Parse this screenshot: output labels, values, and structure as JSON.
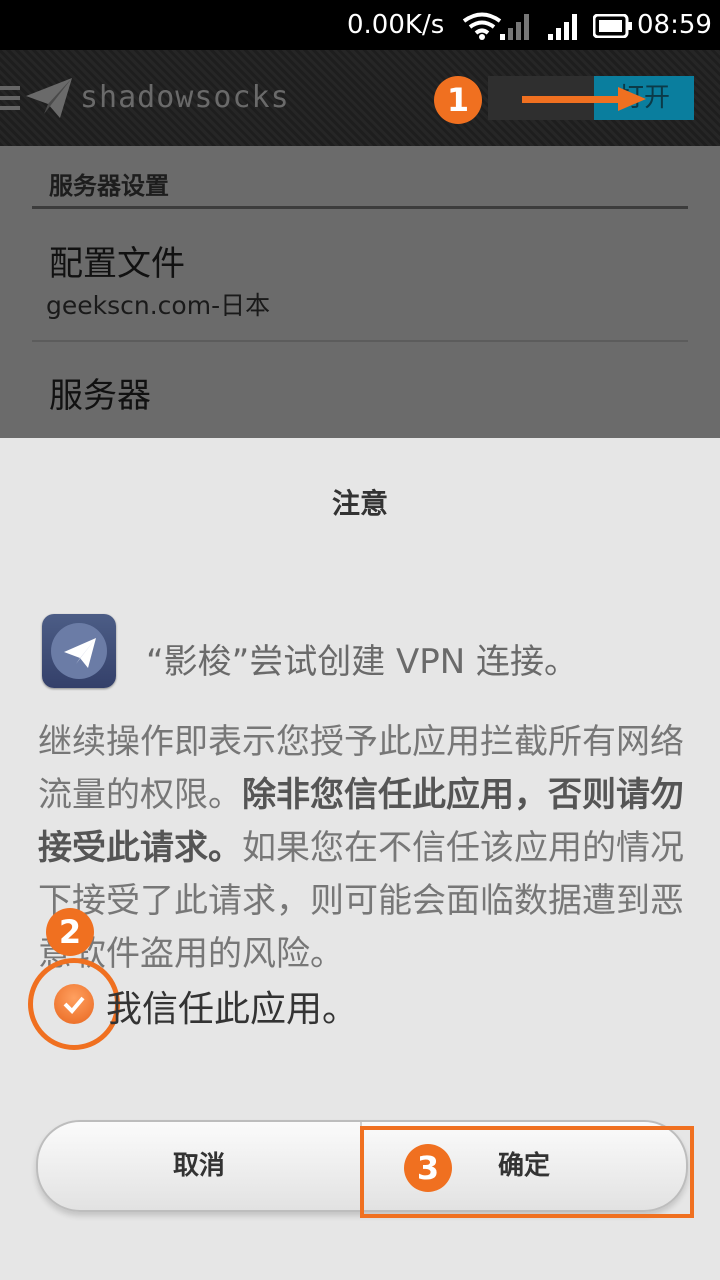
{
  "status_bar": {
    "network_speed": "0.00K/s",
    "time": "08:59",
    "icons": [
      "wifi-icon",
      "signal-icon",
      "signal-icon",
      "battery-icon"
    ]
  },
  "action_bar": {
    "app_title": "shadowsocks",
    "toggle_label": "打开",
    "icons": [
      "menu-icon",
      "paper-plane-icon"
    ]
  },
  "annotations": {
    "step1": "1",
    "step2": "2",
    "step3": "3",
    "accent_color": "#f07020"
  },
  "settings": {
    "section_header": "服务器设置",
    "profile": {
      "title": "配置文件",
      "subtitle": "geekscn.com-日本"
    },
    "server": {
      "title": "服务器"
    }
  },
  "dialog": {
    "title": "注意",
    "vpn_message": "“影梭”尝试创建 VPN 连接。",
    "warning_plain_1": "继续操作即表示您授予此应用拦截所有网络流量的权限。",
    "warning_bold": "除非您信任此应用，否则请勿接受此请求。",
    "warning_plain_2": "如果您在不信任该应用的情况下接受了此请求，则可能会面临数据遭到恶意软件盗用的风险。",
    "trust_checkbox_label": "我信任此应用。",
    "trust_checked": true,
    "cancel_button": "取消",
    "ok_button": "确定"
  }
}
